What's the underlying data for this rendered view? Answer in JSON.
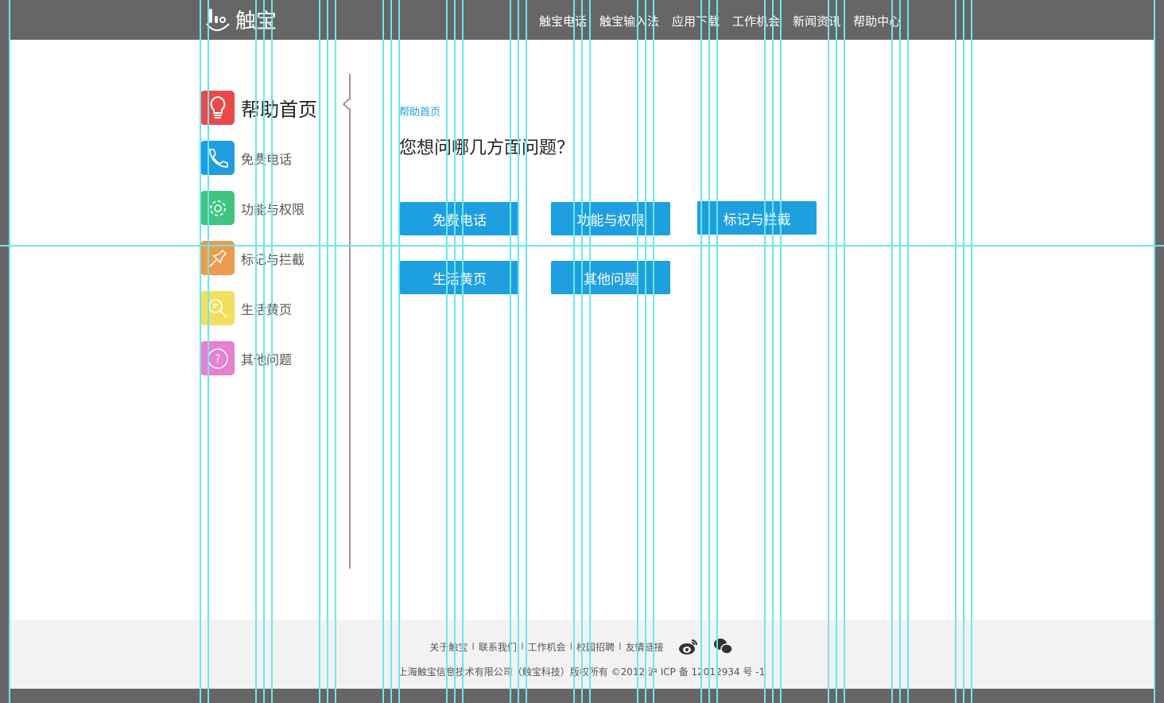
{
  "header": {
    "logo_text": "触宝",
    "nav": [
      "触宝电话",
      "触宝输入法",
      "应用下载",
      "工作机会",
      "新闻资讯",
      "帮助中心"
    ]
  },
  "sidebar": {
    "items": [
      {
        "label": "帮助首页",
        "icon": "lightbulb-icon",
        "color": "#e84a4a"
      },
      {
        "label": "免费电话",
        "icon": "phone-icon",
        "color": "#1e9de0"
      },
      {
        "label": "功能与权限",
        "icon": "gear-icon",
        "color": "#3fc57e"
      },
      {
        "label": "标记与拦截",
        "icon": "pin-icon",
        "color": "#ee9a4c"
      },
      {
        "label": "生活黄页",
        "icon": "search-icon",
        "color": "#f2df5e"
      },
      {
        "label": "其他问题",
        "icon": "question-icon",
        "color": "#e87fd0"
      }
    ]
  },
  "main": {
    "breadcrumb": "帮助首页",
    "question": "您想问哪几方面问题？",
    "buttons": [
      "免费电话",
      "功能与权限",
      "标记与拦截",
      "生活黄页",
      "其他问题"
    ],
    "accent": "#1ea0e0"
  },
  "footer": {
    "links": [
      "关于触宝",
      "联系我们",
      "工作机会",
      "校园招聘",
      "友情链接"
    ],
    "separator": "I",
    "copyright": "上海触宝信息技术有限公司（触宝科技）版权所有 ©2012 沪 ICP 备 12012934 号 -1"
  }
}
